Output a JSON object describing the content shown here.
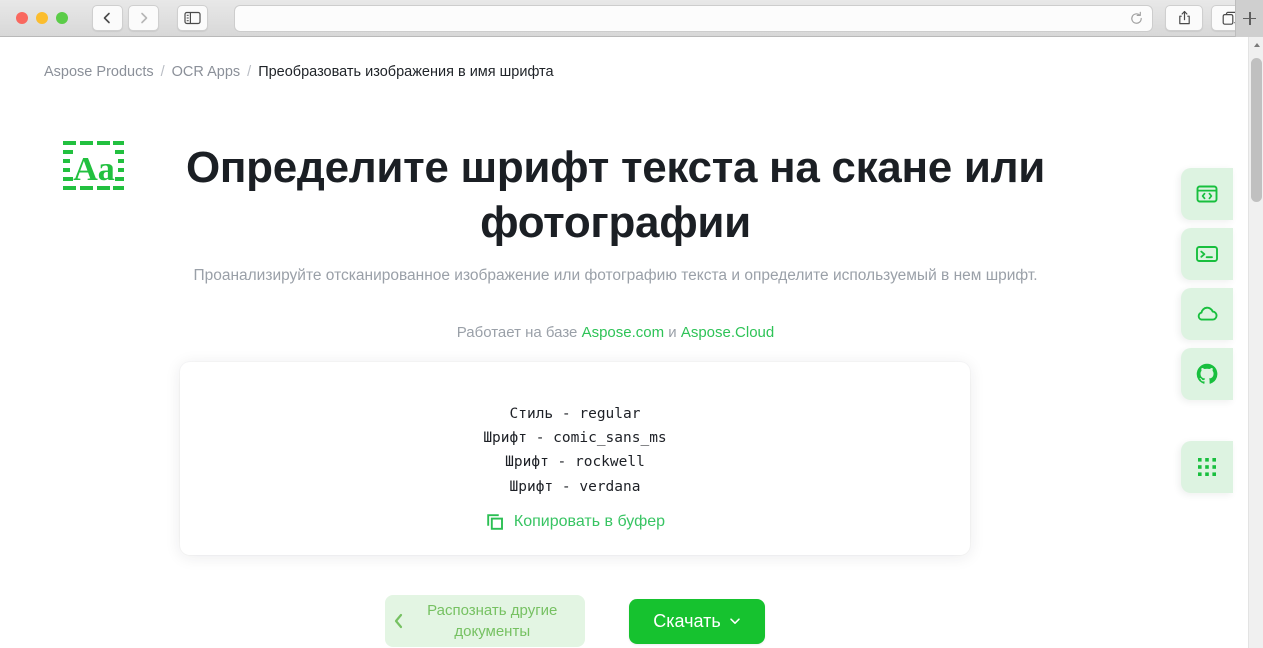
{
  "browser": {
    "url_value": "",
    "url_placeholder": "",
    "back_icon": "chevron-left-icon",
    "forward_icon": "chevron-right-icon",
    "sidebar_icon": "sidebar-toggle-icon",
    "reload_icon": "reload-icon",
    "share_icon": "share-icon",
    "tabs_icon": "tab-overview-icon",
    "newtab_icon": "plus-icon"
  },
  "breadcrumb": {
    "items": [
      {
        "label": "Aspose Products",
        "current": false
      },
      {
        "label": "OCR Apps",
        "current": false
      },
      {
        "label": "Преобразовать изображения в имя шрифта",
        "current": true
      }
    ],
    "separator": "/"
  },
  "hero": {
    "logo_icon": "aa-scan-font-logo-icon",
    "title": "Определите шрифт текста на скане или фотографии",
    "subtitle": "Проанализируйте отсканированное изображение или фотографию текста и определите используемый в нем шрифт.",
    "powered_prefix": "Работает на базе ",
    "powered_link_1": "Aspose.com",
    "powered_conjunction": " и ",
    "powered_link_2": "Aspose.Cloud"
  },
  "result": {
    "lines": [
      "Стиль - regular",
      "Шрифт - comic_sans_ms",
      "Шрифт - rockwell",
      "Шрифт - verdana"
    ],
    "copy_icon": "copy-icon",
    "copy_label": "Копировать в буфер"
  },
  "actions": {
    "back_icon": "chevron-left-icon",
    "back_label": "Распознать другие документы",
    "download_label": "Скачать",
    "download_chevron_icon": "chevron-down-icon"
  },
  "side_rail": {
    "items": [
      {
        "icon": "code-window-icon",
        "name": "api-reference"
      },
      {
        "icon": "terminal-icon",
        "name": "cli-terminal"
      },
      {
        "icon": "cloud-icon",
        "name": "cloud-services"
      },
      {
        "icon": "github-icon",
        "name": "github-repo"
      },
      {
        "icon": "grid-apps-icon",
        "name": "all-apps"
      }
    ]
  },
  "colors": {
    "brand_green": "#16c22f",
    "link_green": "#2ec357",
    "soft_green_bg": "#ddf3e1",
    "back_button_bg": "#e3f5e3",
    "back_button_text": "#76c162",
    "text_dark": "#1b1f24",
    "text_muted": "#9aa0a8"
  }
}
